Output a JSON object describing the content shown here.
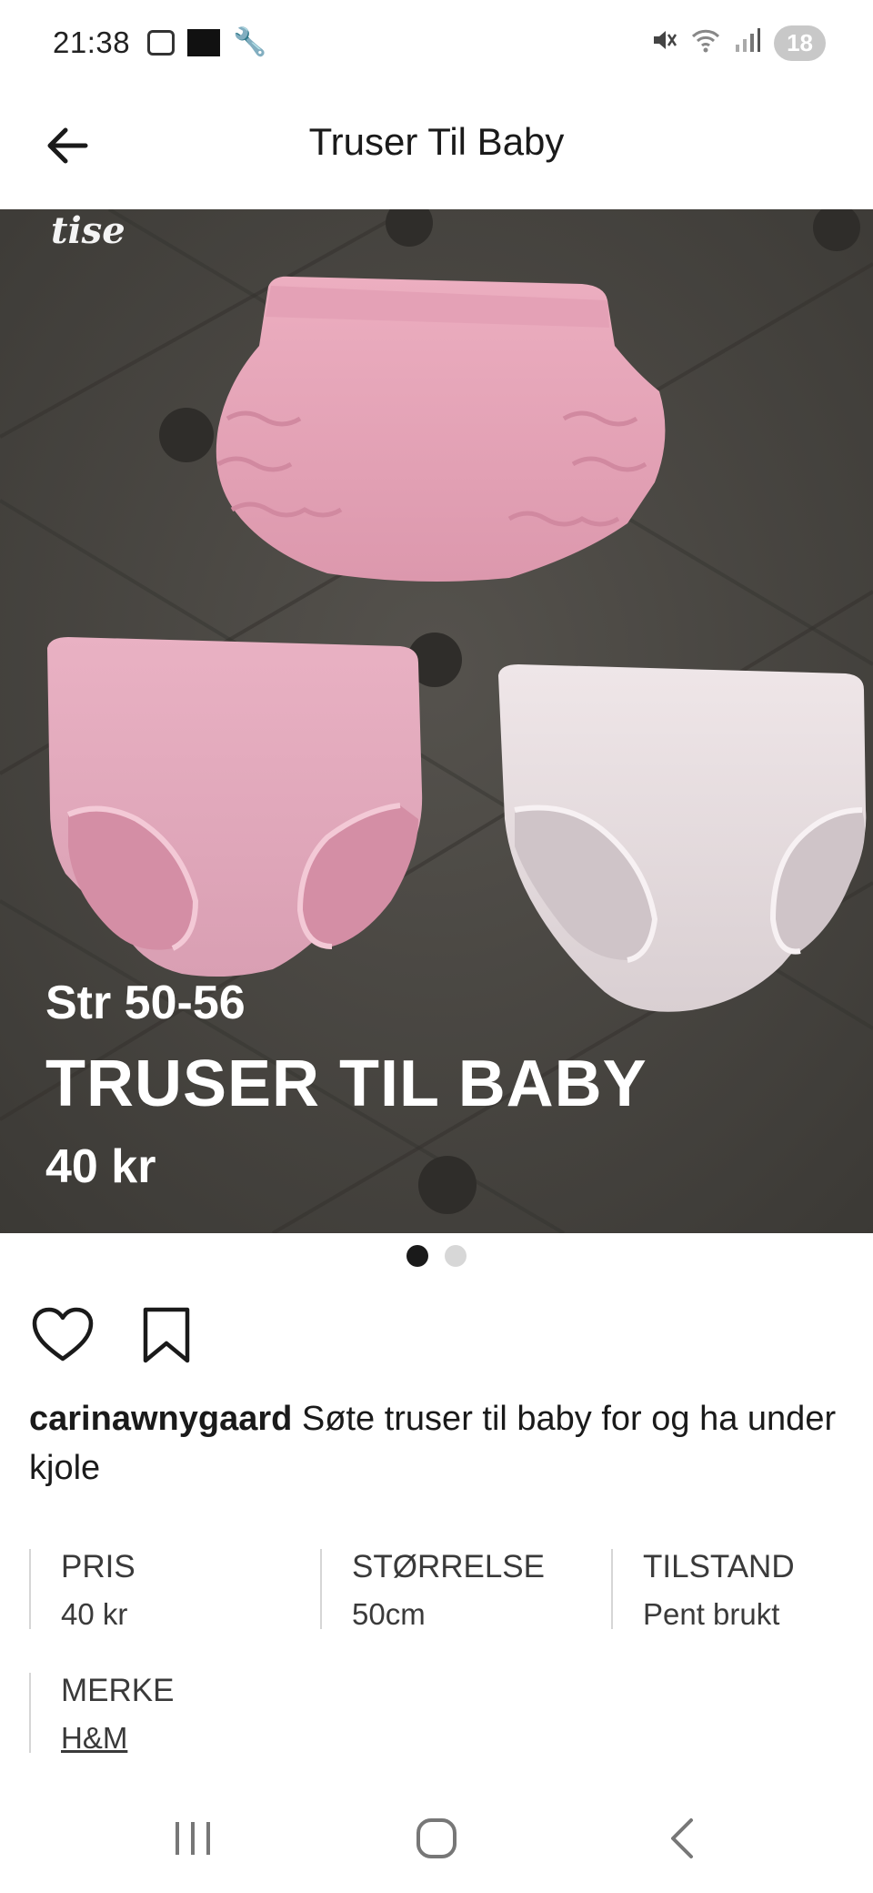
{
  "status_bar": {
    "time": "21:38",
    "left_icons": [
      "screenshot-icon",
      "app-logo-icon",
      "wrench-icon"
    ],
    "right_icons": [
      "mute-icon",
      "wifi-icon",
      "signal-icon"
    ],
    "battery_level": "18"
  },
  "header": {
    "title": "Truser Til Baby",
    "back_icon": "arrow-left-icon"
  },
  "image": {
    "watermark": "tise",
    "overlay_size": "Str 50-56",
    "overlay_title": "TRUSER TIL BABY",
    "overlay_price": "40 kr",
    "carousel_count": 2,
    "carousel_active": 0
  },
  "actions": {
    "like_icon": "heart-icon",
    "save_icon": "bookmark-icon"
  },
  "description": {
    "username": "carinawnygaard",
    "text": " Søte truser til baby for og ha under kjole"
  },
  "details": [
    {
      "label": "PRIS",
      "value": "40 kr"
    },
    {
      "label": "STØRRELSE",
      "value": "50cm"
    },
    {
      "label": "TILSTAND",
      "value": "Pent brukt"
    },
    {
      "label": "MERKE",
      "value": "H&M"
    }
  ],
  "nav_bar": {
    "recents_icon": "recents-icon",
    "home_icon": "home-icon",
    "back_icon": "back-chevron-icon"
  },
  "colors": {
    "background": "#ffffff",
    "text": "#1a1a1a",
    "muted_text": "#3a3a3a",
    "divider": "#d6d6d6",
    "dot_active": "#1a1a1a",
    "dot_inactive": "#d7d7d7"
  }
}
